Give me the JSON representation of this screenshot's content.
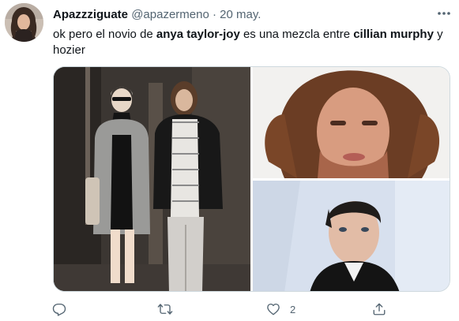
{
  "tweet": {
    "display_name": "Apazzziguate",
    "handle": "@apazermeno",
    "separator": "·",
    "date": "20 may.",
    "text_parts": [
      {
        "text": "ok pero el novio de ",
        "bold": false
      },
      {
        "text": "anya taylor-joy",
        "bold": true
      },
      {
        "text": " es una mezcla entre ",
        "bold": false
      },
      {
        "text": "cillian murphy",
        "bold": true
      },
      {
        "text": " y hozier",
        "bold": false
      }
    ]
  },
  "actions": {
    "reply_count": "",
    "retweet_count": "",
    "like_count": "2",
    "share_count": ""
  },
  "icons": {
    "more": "more-horizontal-icon",
    "reply": "reply-icon",
    "retweet": "retweet-icon",
    "like": "heart-icon",
    "share": "share-icon"
  },
  "colors": {
    "text": "#0f1419",
    "secondary": "#536471",
    "border": "#cfd9de"
  }
}
